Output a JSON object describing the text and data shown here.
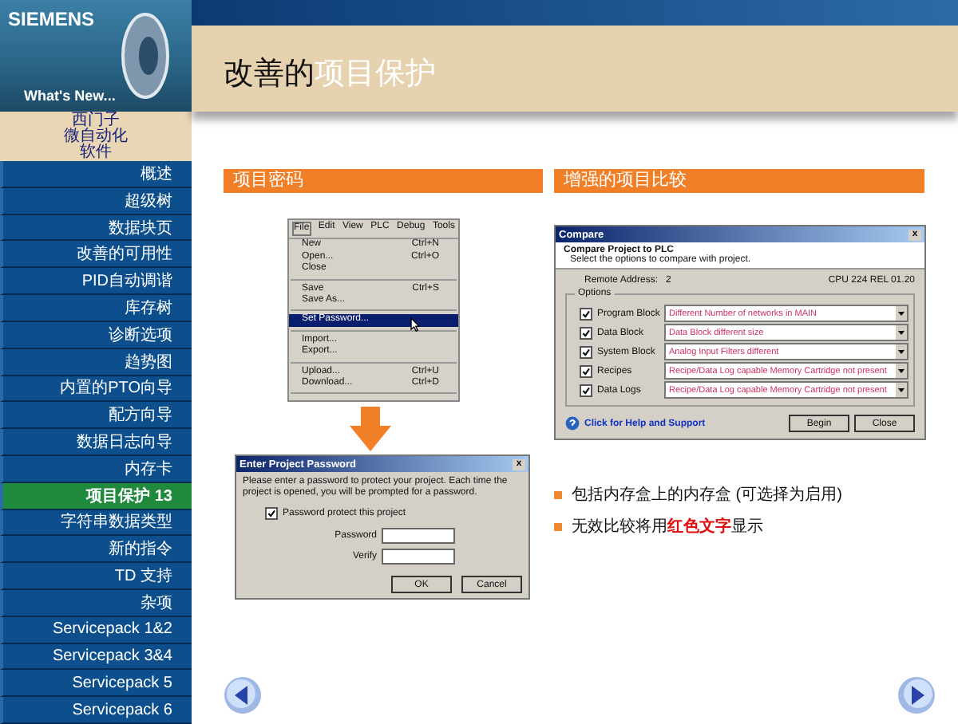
{
  "logo": {
    "brand": "SIEMENS",
    "tagline": "What's New..."
  },
  "caption": [
    "西门子",
    "微自动化",
    "软件"
  ],
  "nav": [
    {
      "label": "概述",
      "selected": false
    },
    {
      "label": "超级树",
      "selected": false
    },
    {
      "label": "数据块页",
      "selected": false
    },
    {
      "label": "改善的可用性",
      "selected": false
    },
    {
      "label": "PID自动调谐",
      "selected": false
    },
    {
      "label": "库存树",
      "selected": false
    },
    {
      "label": "诊断选项",
      "selected": false
    },
    {
      "label": "趋势图",
      "selected": false
    },
    {
      "label": "内置的PTO向导",
      "selected": false
    },
    {
      "label": "配方向导",
      "selected": false
    },
    {
      "label": "数据日志向导",
      "selected": false
    },
    {
      "label": "内存卡",
      "selected": false
    },
    {
      "label": "项目保护 13",
      "selected": true
    },
    {
      "label": "字符串数据类型",
      "selected": false
    },
    {
      "label": "新的指令",
      "selected": false
    },
    {
      "label": "TD 支持",
      "selected": false
    },
    {
      "label": "杂项",
      "selected": false
    },
    {
      "label": "Servicepack 1&2",
      "selected": false
    },
    {
      "label": "Servicepack 3&4",
      "selected": false
    },
    {
      "label": "Servicepack 5",
      "selected": false
    },
    {
      "label": "Servicepack 6",
      "selected": false
    }
  ],
  "title": {
    "plain": "改善的",
    "highlight": "项目保护"
  },
  "left_section": {
    "heading": "项目密码",
    "menu": {
      "bar": [
        "File",
        "Edit",
        "View",
        "PLC",
        "Debug",
        "Tools"
      ],
      "items": [
        {
          "kind": "item",
          "label": "New",
          "shortcut": "Ctrl+N",
          "selected": false
        },
        {
          "kind": "item",
          "label": "Open...",
          "shortcut": "Ctrl+O",
          "selected": false
        },
        {
          "kind": "item",
          "label": "Close",
          "selected": false
        },
        {
          "kind": "separator"
        },
        {
          "kind": "item",
          "label": "Save",
          "shortcut": "Ctrl+S",
          "selected": false
        },
        {
          "kind": "item",
          "label": "Save As...",
          "selected": false
        },
        {
          "kind": "separator"
        },
        {
          "kind": "item",
          "label": "Set Password...",
          "selected": true
        },
        {
          "kind": "separator"
        },
        {
          "kind": "item",
          "label": "Import...",
          "selected": false
        },
        {
          "kind": "item",
          "label": "Export...",
          "selected": false
        },
        {
          "kind": "separator"
        },
        {
          "kind": "item",
          "label": "Upload...",
          "shortcut": "Ctrl+U",
          "selected": false
        },
        {
          "kind": "item",
          "label": "Download...",
          "shortcut": "Ctrl+D",
          "selected": false
        },
        {
          "kind": "separator"
        }
      ]
    },
    "password_dialog": {
      "title": "Enter Project Password",
      "close": "x",
      "message": "Please enter a password to protect your project.  Each time the project is opened, you will be prompted for a password.",
      "checkbox": {
        "label": "Password protect this project",
        "checked": true
      },
      "fields": [
        {
          "label": "Password"
        },
        {
          "label": "Verify"
        }
      ],
      "buttons": [
        "OK",
        "Cancel"
      ]
    }
  },
  "right_section": {
    "heading": "增强的项目比较",
    "compare_dialog": {
      "title": "Compare",
      "close": "x",
      "heading": "Compare Project to PLC",
      "subheading": "Select the options to compare with project.",
      "remote_label": "Remote Address:",
      "remote_value": "2",
      "cpu": "CPU 224 REL 01.20",
      "group": "Options",
      "options": [
        {
          "label": "Program Block",
          "checked": true,
          "result": "Different Number of networks in MAIN"
        },
        {
          "label": "Data Block",
          "checked": true,
          "result": "Data Block different size"
        },
        {
          "label": "System Block",
          "checked": true,
          "result": "Analog Input Filters different"
        },
        {
          "label": "Recipes",
          "checked": true,
          "result": "Recipe/Data Log capable Memory Cartridge not present"
        },
        {
          "label": "Data Logs",
          "checked": true,
          "result": "Recipe/Data Log capable Memory Cartridge not present"
        }
      ],
      "help_link": "Click for Help and Support",
      "buttons": [
        "Begin",
        "Close"
      ]
    },
    "bullets": [
      "包括内存盒上的内存盒 (可选择为启用)",
      "无效比较将用**红色文字**显示"
    ]
  }
}
